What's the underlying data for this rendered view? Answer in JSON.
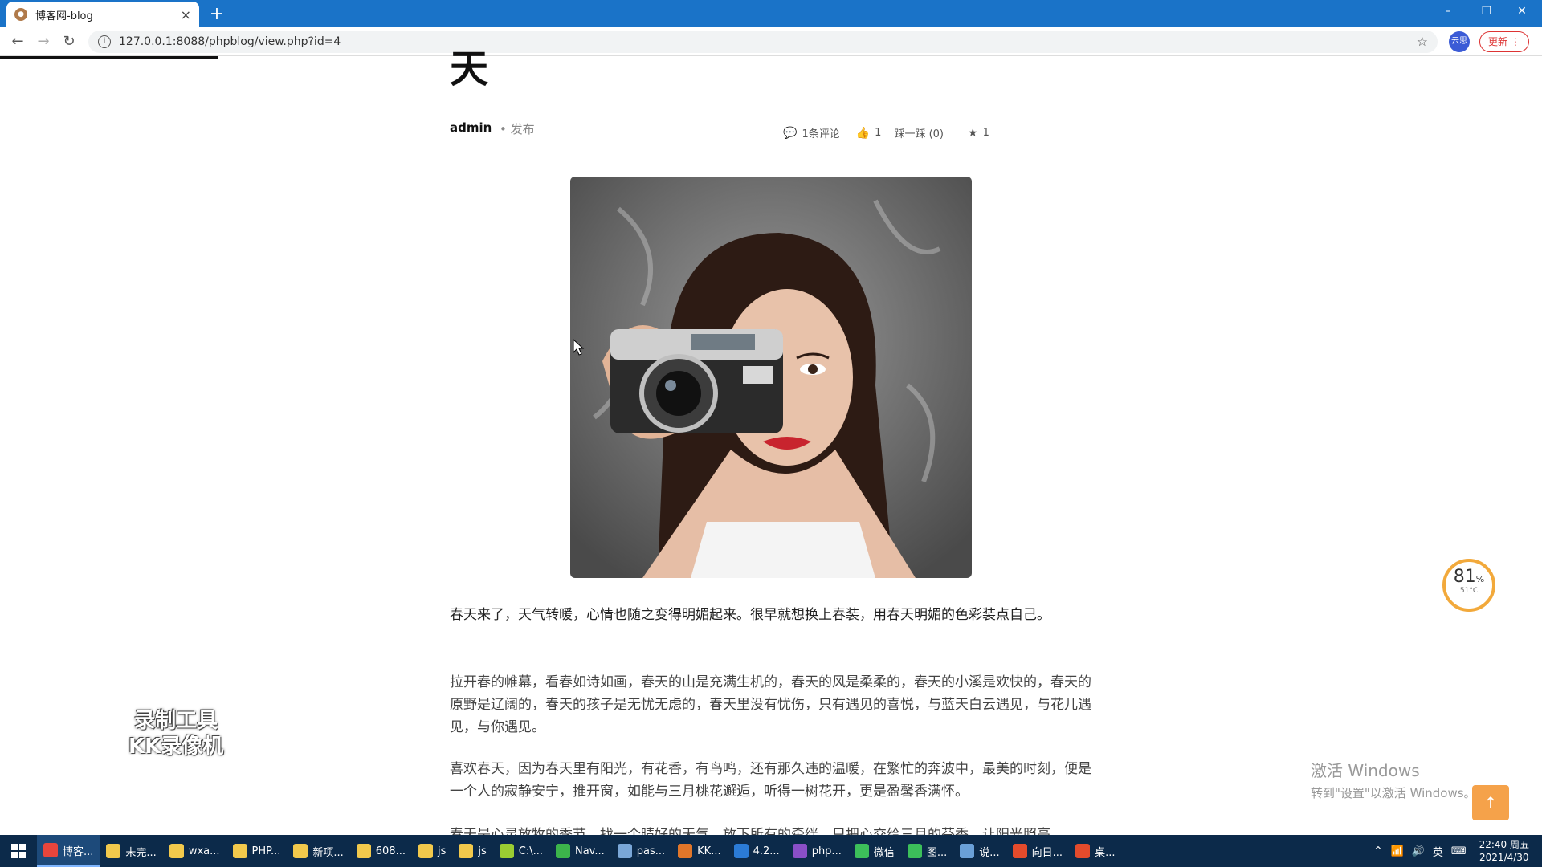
{
  "browser": {
    "tab_title": "博客网-blog",
    "tab_close": "×",
    "new_tab": "+",
    "url": "127.0.0.1:8088/phpblog/view.php?id=4",
    "update_label": "更新",
    "ext_label": "云思"
  },
  "window_controls": {
    "minimize": "–",
    "restore": "❐",
    "close": "✕"
  },
  "post": {
    "title_fragment": "天",
    "author": "admin",
    "publish": "• 发布",
    "comments": "1条评论",
    "likes": "1",
    "dislike": "踩一踩 (0)",
    "favorites": "1",
    "paragraphs": [
      "    春天来了，天气转暖，心情也随之变得明媚起来。很早就想换上春装，用春天明媚的色彩装点自己。",
      "拉开春的帷幕，看春如诗如画，春天的山是充满生机的，春天的风是柔柔的，春天的小溪是欢快的，春天的原野是辽阔的，春天的孩子是无忧无虑的，春天里没有忧伤，只有遇见的喜悦，与蓝天白云遇见，与花儿遇见，与你遇见。",
      "喜欢春天，因为春天里有阳光，有花香，有鸟鸣，还有那久违的温暖，在繁忙的奔波中，最美的时刻，便是一个人的寂静安宁，推开窗，如能与三月桃花邂逅，听得一树花开，更是盈馨香满怀。",
      "春天是心灵放牧的季节，找一个晴好的天气，放下所有的牵绊，只把心交给三月的芬香，让阳光照亮"
    ]
  },
  "gauge": {
    "percent": "81",
    "percent_unit": "%",
    "temp": "51°C"
  },
  "watermark": {
    "line1": "激活 Windows",
    "line2": "转到\"设置\"以激活 Windows。"
  },
  "back_to_top": "↑",
  "recorder_watermark": {
    "line1": "录制工具",
    "line2": "KK录像机"
  },
  "taskbar": {
    "items": [
      {
        "label": "博客...",
        "color": "#e8453c"
      },
      {
        "label": "未完...",
        "color": "#f2c94c"
      },
      {
        "label": "wxa...",
        "color": "#f2c94c"
      },
      {
        "label": "PHP...",
        "color": "#f2c94c"
      },
      {
        "label": "新项...",
        "color": "#f2c94c"
      },
      {
        "label": "608...",
        "color": "#f2c94c"
      },
      {
        "label": "js",
        "color": "#f2c94c"
      },
      {
        "label": "js",
        "color": "#f2c94c"
      },
      {
        "label": "C:\\...",
        "color": "#9acd32"
      },
      {
        "label": "Nav...",
        "color": "#3cb44b"
      },
      {
        "label": "pas...",
        "color": "#7aa7d8"
      },
      {
        "label": "KK...",
        "color": "#e0762a"
      },
      {
        "label": "4.2...",
        "color": "#2b7bd6"
      },
      {
        "label": "php...",
        "color": "#8a4fc7"
      },
      {
        "label": "微信",
        "color": "#3cbf5a"
      },
      {
        "label": "图...",
        "color": "#3cbf5a"
      },
      {
        "label": "说...",
        "color": "#6aa0d8"
      },
      {
        "label": "向日...",
        "color": "#e44b2c"
      },
      {
        "label": "桌...",
        "color": "#e44b2c"
      }
    ],
    "ime": "英",
    "time": "22:40 周五",
    "date": "2021/4/30"
  }
}
